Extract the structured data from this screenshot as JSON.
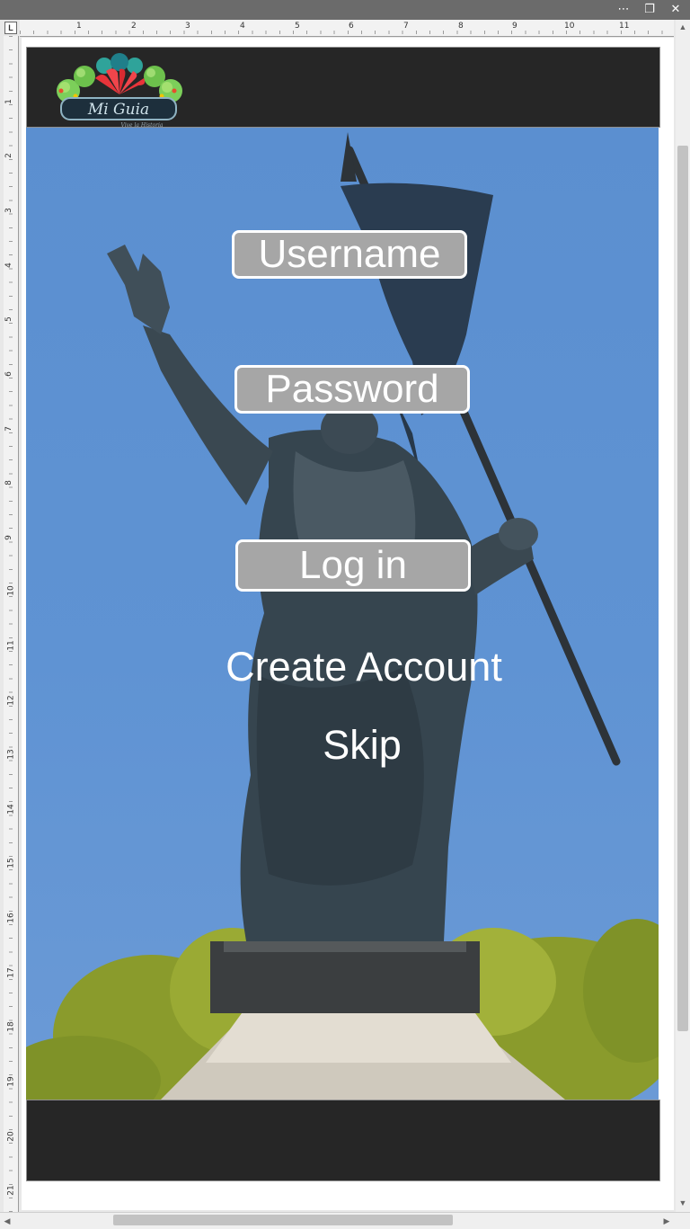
{
  "window": {
    "more_icon": "more-horizontal-icon",
    "restore_icon": "restore-window-icon",
    "close_icon": "close-icon"
  },
  "ruler": {
    "corner_label": "L",
    "horizontal": [
      "1",
      "2",
      "3",
      "4",
      "5",
      "6",
      "7",
      "8",
      "9",
      "10",
      "11"
    ],
    "vertical": [
      "1",
      "2",
      "3",
      "4",
      "5",
      "6",
      "7",
      "8",
      "9",
      "10",
      "11",
      "12",
      "13",
      "14",
      "15",
      "16",
      "17",
      "18",
      "19",
      "20",
      "21"
    ]
  },
  "logo": {
    "title_text": "Mi Guia",
    "tagline": "Vive la Historia"
  },
  "login": {
    "username_label": "Username",
    "password_label": "Password",
    "login_label": "Log in",
    "create_account_label": "Create Account",
    "skip_label": "Skip"
  },
  "colors": {
    "bar_dark": "#262626",
    "sky_blue": "#5b8fd0",
    "field_gray": "#a6a6a6",
    "text_white": "#ffffff"
  }
}
